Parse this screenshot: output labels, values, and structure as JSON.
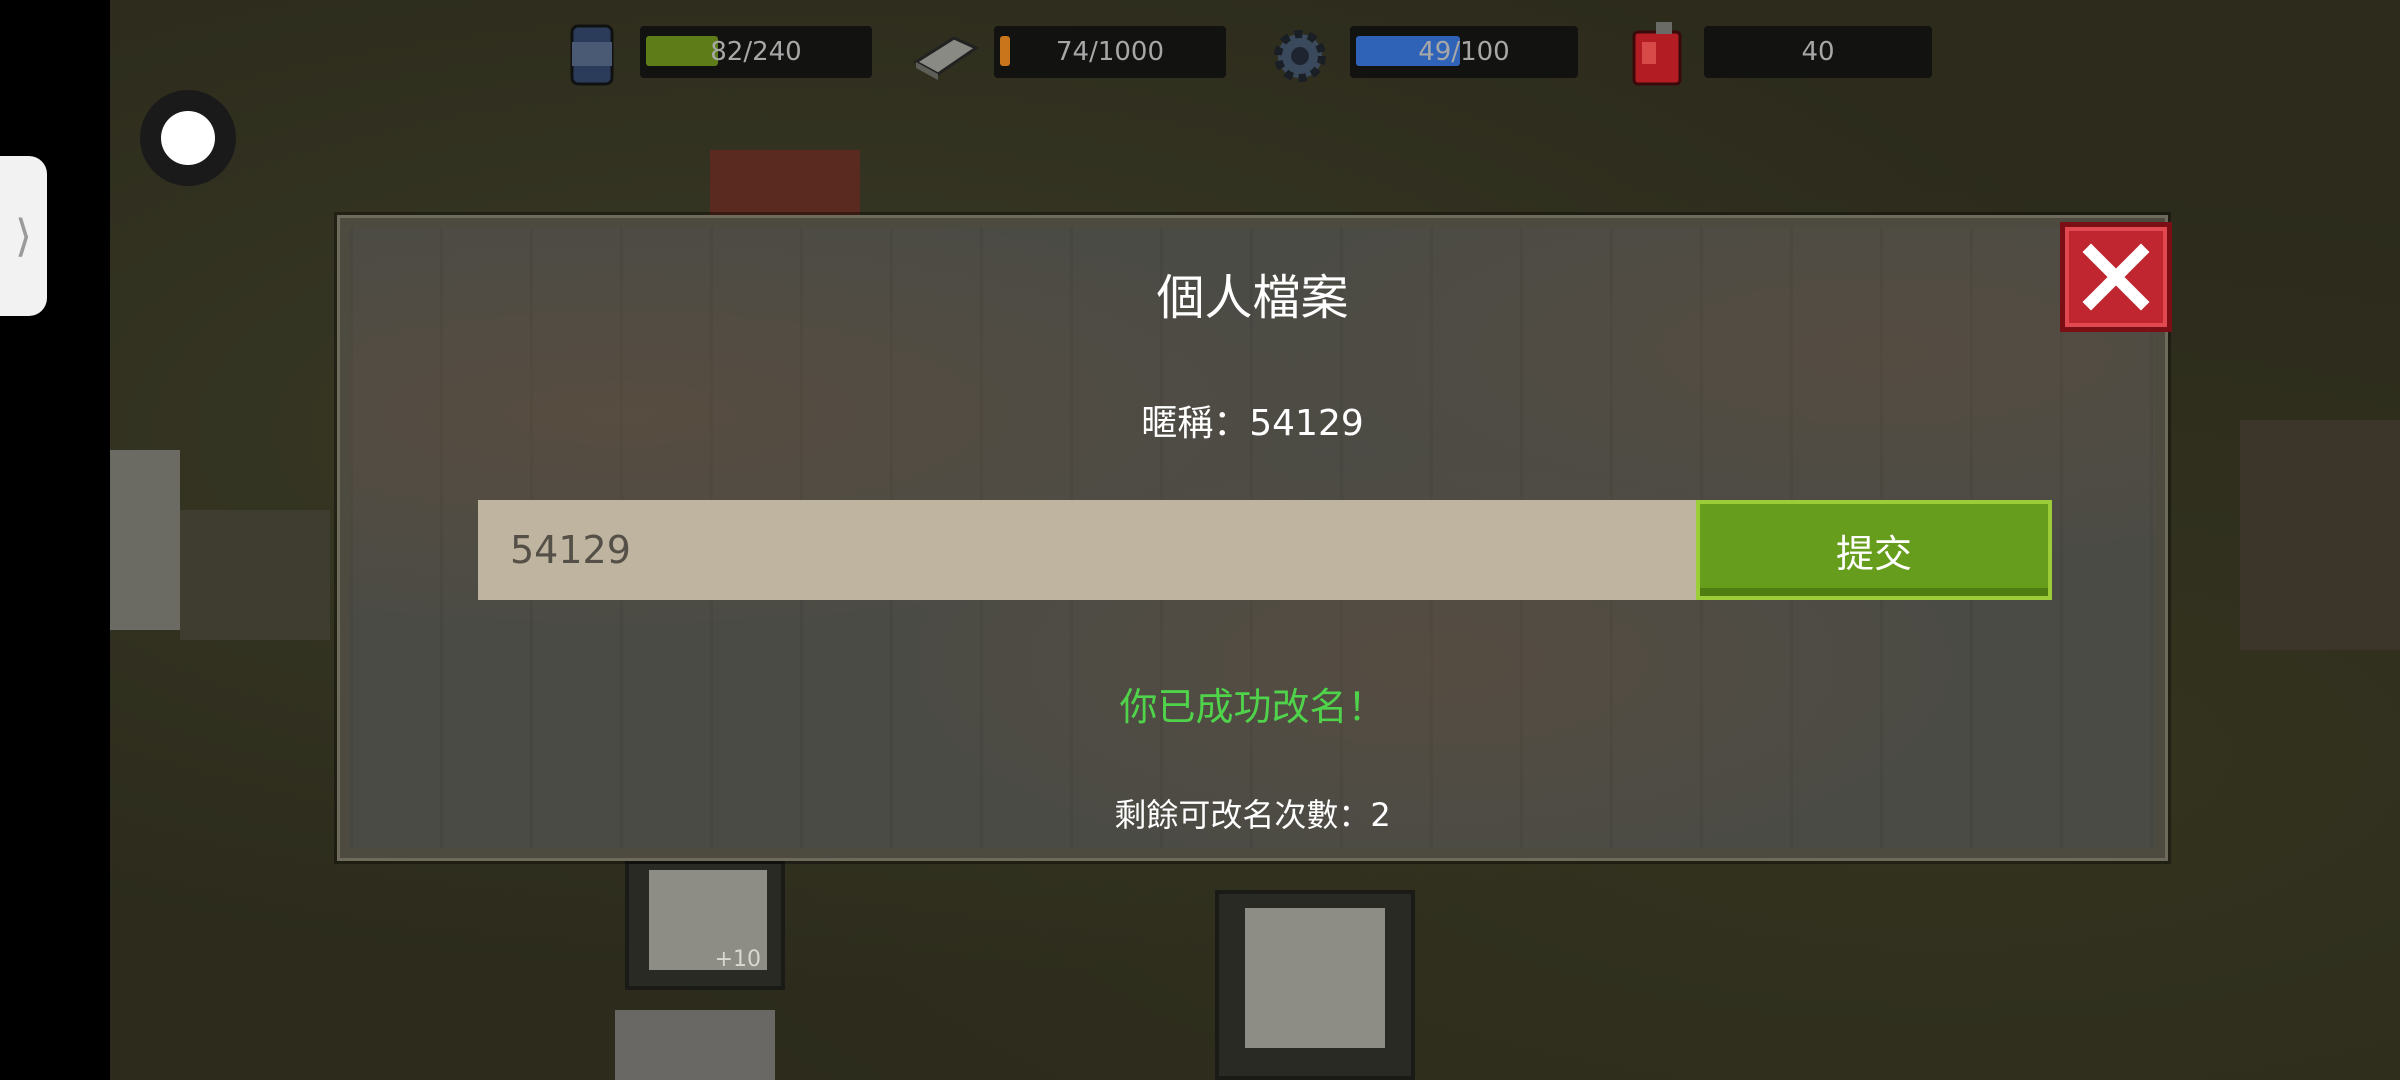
{
  "hud": {
    "food": {
      "icon": "can-icon",
      "text": "82/240",
      "fraction": 0.34,
      "color": "#6b8f1c"
    },
    "material": {
      "icon": "plank-icon",
      "text": "74/1000",
      "fraction": 0.074,
      "color": "#c8751c"
    },
    "parts": {
      "icon": "gear-icon",
      "text": "49/100",
      "fraction": 0.49,
      "color": "#2f63b8"
    },
    "fuel": {
      "icon": "fuel-can-icon",
      "text": "40"
    }
  },
  "dialog": {
    "title": "個人檔案",
    "nickname_line": "暱稱：54129",
    "input_value": "54129",
    "submit_label": "提交",
    "success_message": "你已成功改名！",
    "remaining_line": "剩餘可改名次數：2",
    "close_icon": "close-icon"
  },
  "scene": {
    "item_count_label": "+10"
  }
}
